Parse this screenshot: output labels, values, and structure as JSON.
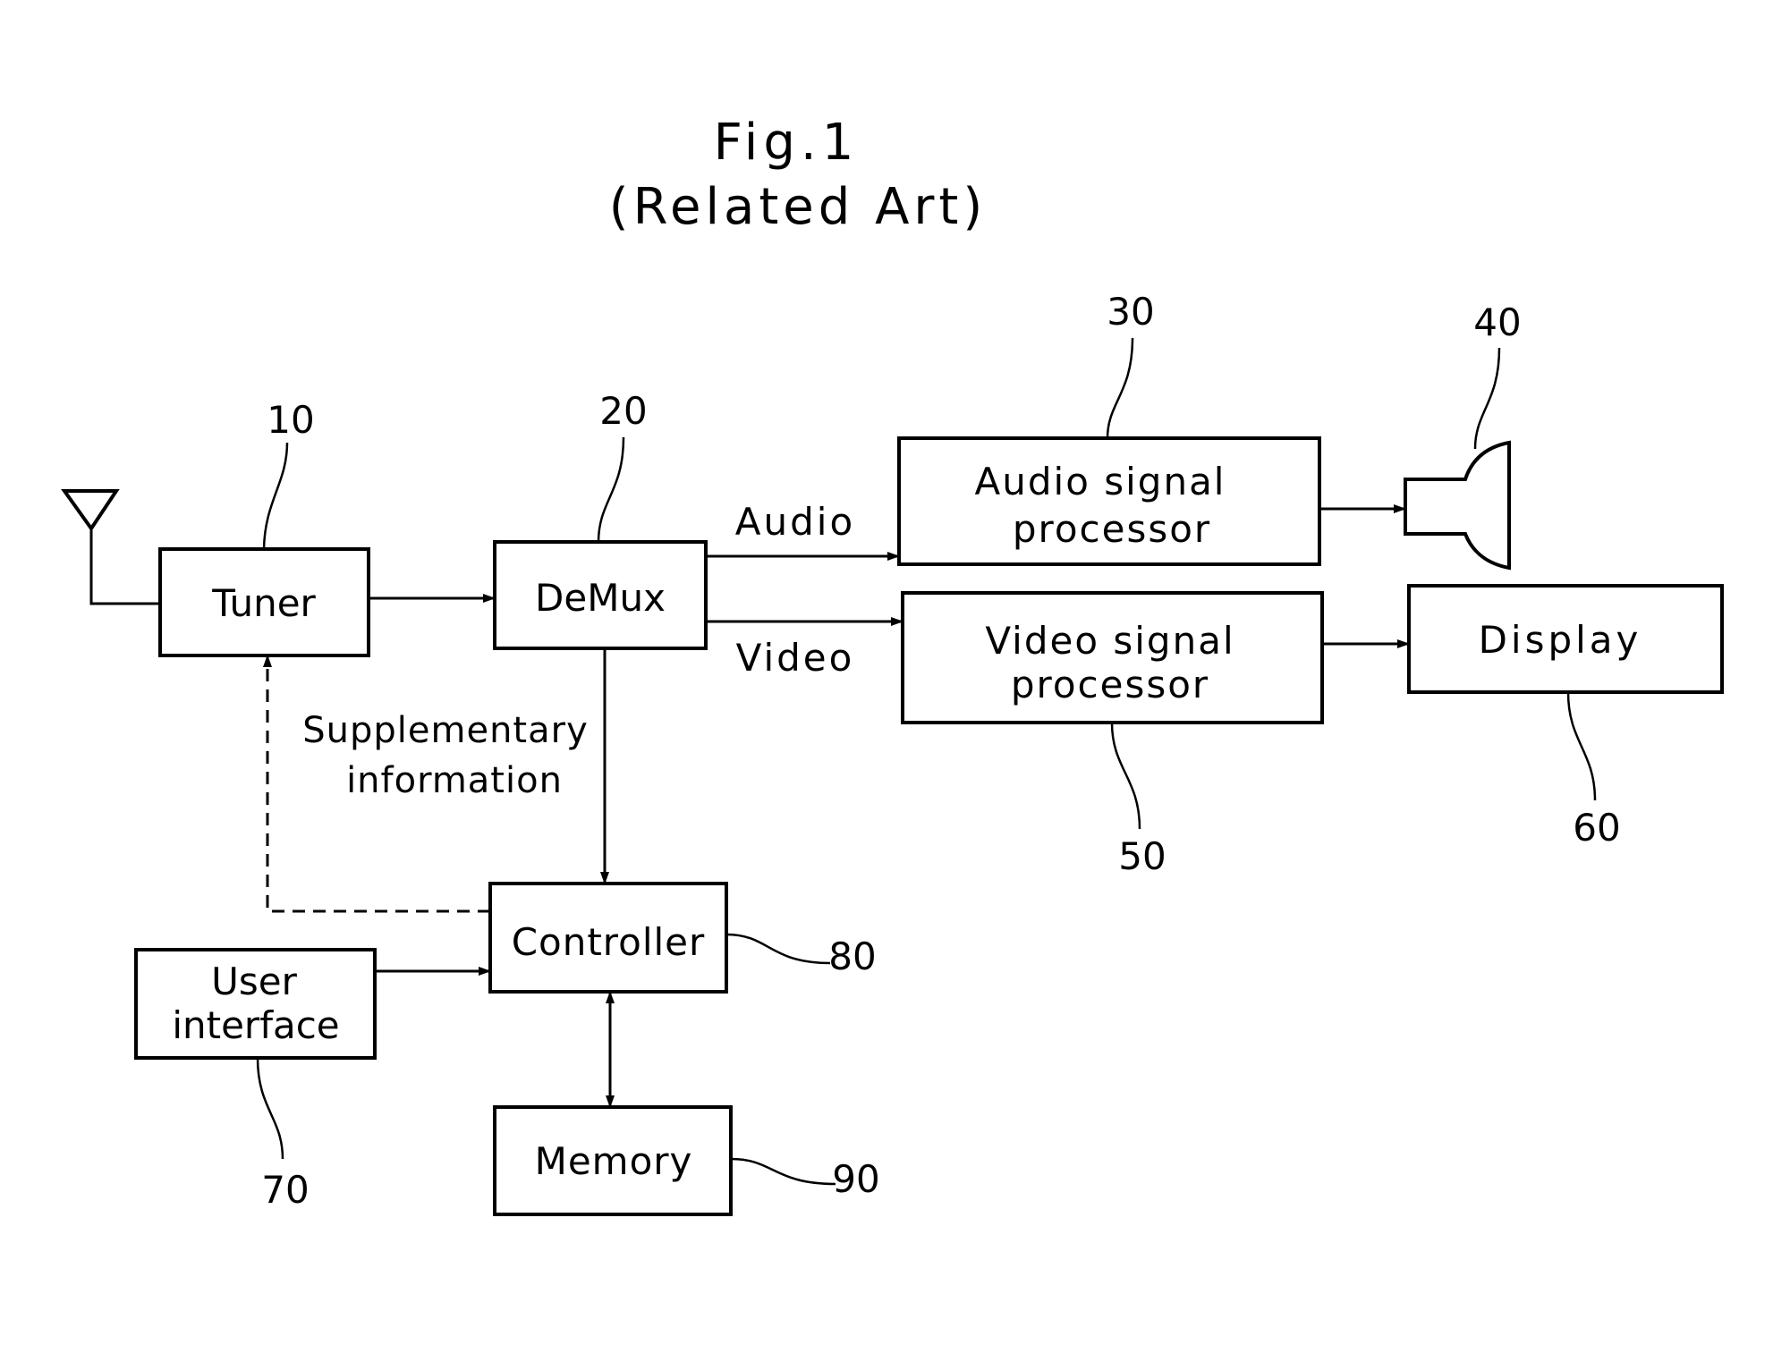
{
  "figure": {
    "title": "Fig.1",
    "subtitle": "(Related Art)"
  },
  "blocks": {
    "tuner": {
      "label": "Tuner",
      "ref": "10"
    },
    "demux": {
      "label": "DeMux",
      "ref": "20"
    },
    "audio_processor": {
      "line1": "Audio signal",
      "line2": "processor",
      "ref": "30"
    },
    "speaker": {
      "ref": "40"
    },
    "video_processor": {
      "line1": "Video signal",
      "line2": "processor",
      "ref": "50"
    },
    "display": {
      "label": "Display",
      "ref": "60"
    },
    "user_interface": {
      "line1": "User",
      "line2": "interface",
      "ref": "70"
    },
    "controller": {
      "label": "Controller",
      "ref": "80"
    },
    "memory": {
      "label": "Memory",
      "ref": "90"
    }
  },
  "signals": {
    "audio": "Audio",
    "video": "Video",
    "supplementary_line1": "Supplementary",
    "supplementary_line2": "information"
  },
  "colors": {
    "ink": "#000000",
    "paper": "#ffffff"
  }
}
